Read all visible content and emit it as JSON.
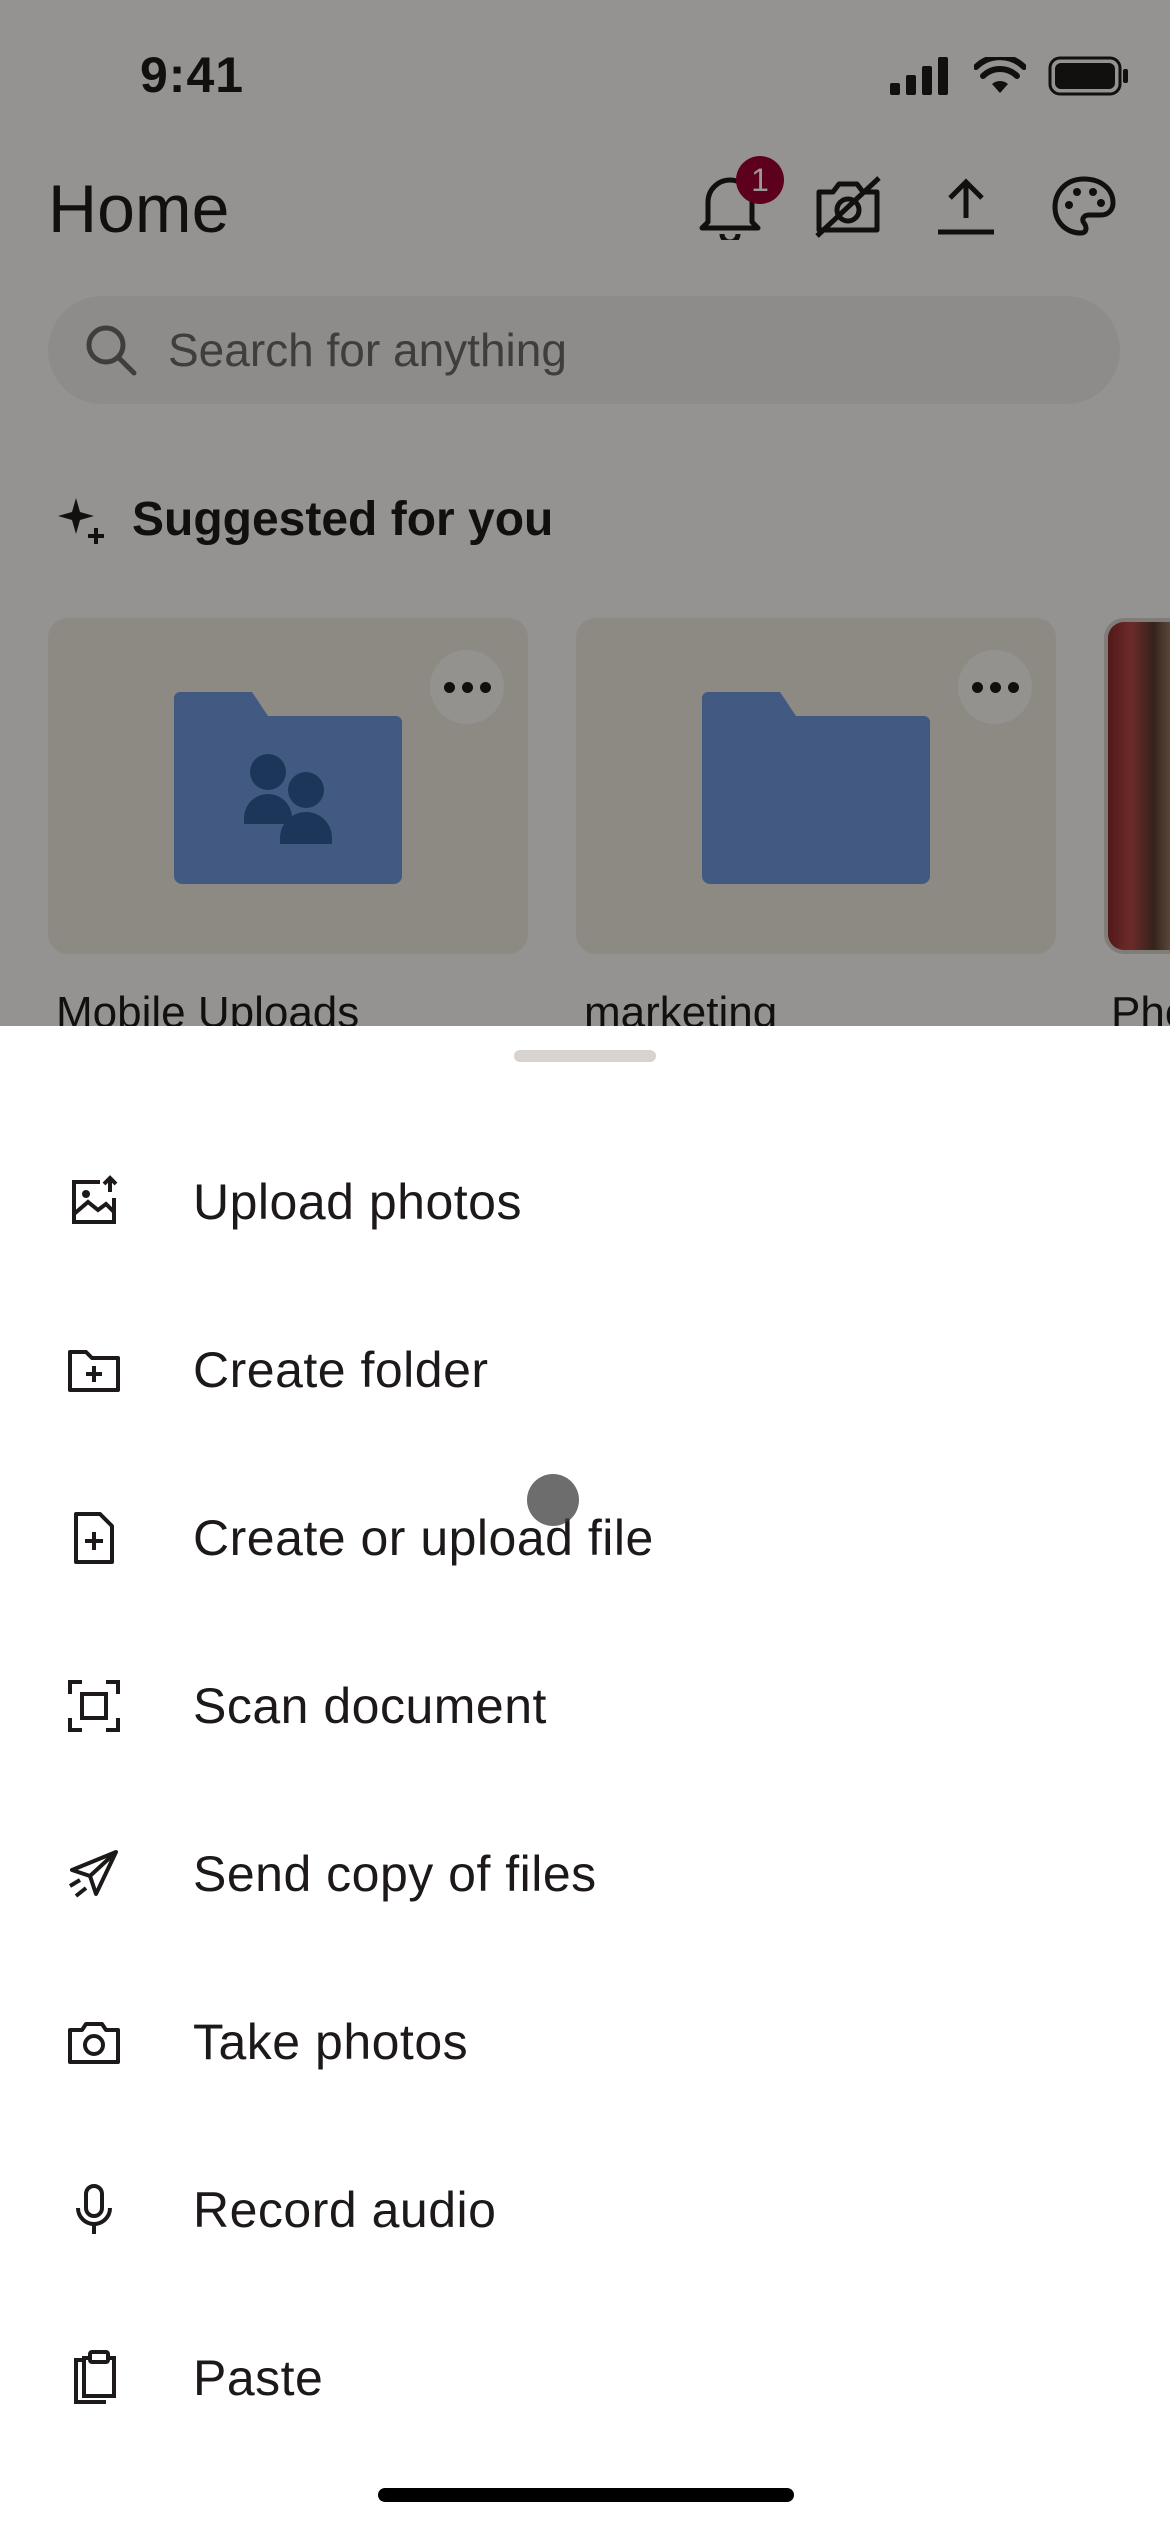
{
  "status_bar": {
    "time": "9:41"
  },
  "header": {
    "title": "Home",
    "notification_count": "1",
    "icons": [
      "bell-icon",
      "camera-off-icon",
      "upload-icon",
      "palette-icon"
    ]
  },
  "search": {
    "placeholder": "Search for anything"
  },
  "suggested": {
    "title": "Suggested for you",
    "cards": [
      {
        "label": "Mobile Uploads",
        "icon": "shared-folder-icon"
      },
      {
        "label": "marketing",
        "icon": "folder-icon"
      },
      {
        "label": "Pho"
      }
    ]
  },
  "sheet": {
    "items": [
      {
        "label": "Upload photos",
        "icon": "upload-photo-icon"
      },
      {
        "label": "Create folder",
        "icon": "create-folder-icon"
      },
      {
        "label": "Create or upload file",
        "icon": "create-file-icon"
      },
      {
        "label": "Scan document",
        "icon": "scan-icon"
      },
      {
        "label": "Send copy of files",
        "icon": "send-icon"
      },
      {
        "label": "Take photos",
        "icon": "camera-icon"
      },
      {
        "label": "Record audio",
        "icon": "microphone-icon"
      },
      {
        "label": "Paste",
        "icon": "clipboard-icon"
      }
    ]
  },
  "colors": {
    "badge": "#9b0032",
    "folder_blue": "#6f97d8",
    "text": "#1e1919"
  }
}
